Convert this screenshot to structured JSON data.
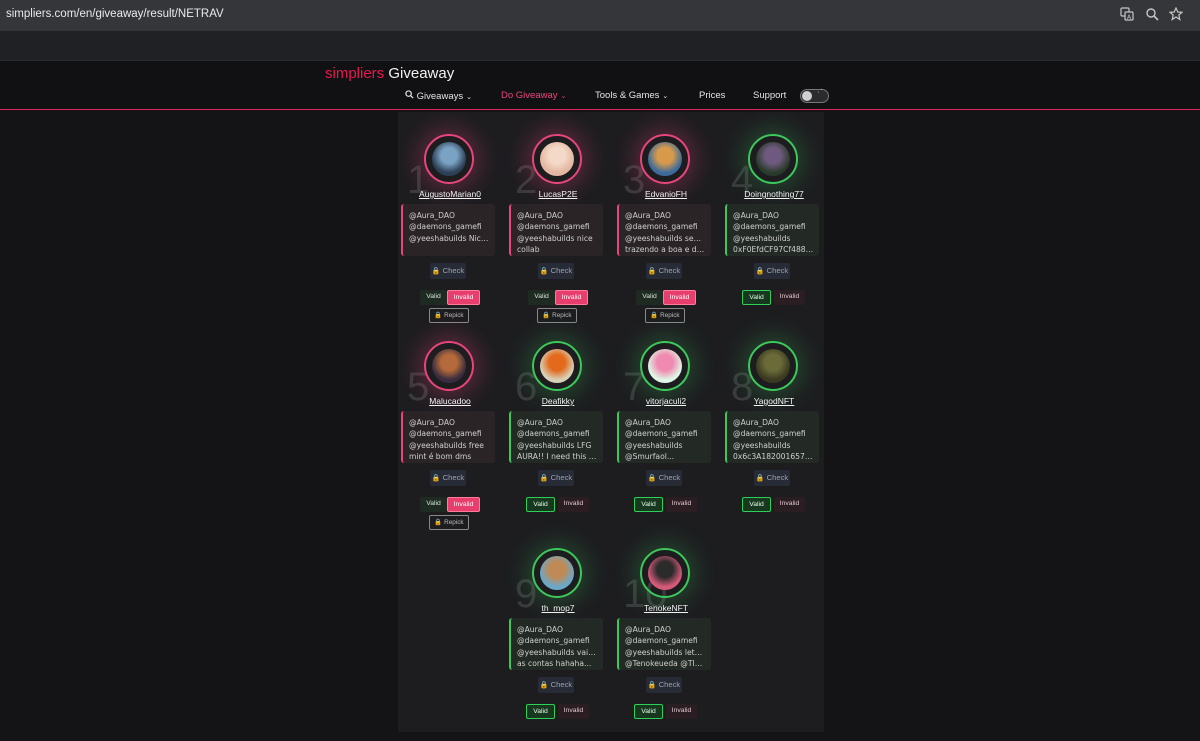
{
  "browser": {
    "url": "simpliers.com/en/giveaway/result/NETRAV",
    "icons": [
      "translate-icon",
      "zoom-icon",
      "bookmark-star-icon"
    ]
  },
  "header": {
    "brand_part1": "simpliers",
    "brand_part2": "Giveaway",
    "nav": {
      "giveaways": "Giveaways",
      "do_giveaway": "Do Giveaway",
      "tools_games": "Tools & Games",
      "prices": "Prices",
      "support": "Support"
    },
    "accent_color": "#e8174f"
  },
  "labels": {
    "check": "Check",
    "valid": "Valid",
    "invalid": "Invalid",
    "repick": "Repick"
  },
  "winners": [
    {
      "rank": "1",
      "username": "AugustoMarian0",
      "status": "invalid",
      "comment": [
        "@Aura_DAO",
        "@daemons_gamefi",
        "@yeeshabuilds Nicee"
      ]
    },
    {
      "rank": "2",
      "username": "LucasP2E",
      "status": "invalid",
      "comment": [
        "@Aura_DAO",
        "@daemons_gamefi",
        "@yeeshabuilds nice",
        "collab"
      ]
    },
    {
      "rank": "3",
      "username": "EdvanioFH",
      "status": "invalid",
      "comment": [
        "@Aura_DAO",
        "@daemons_gamefi",
        "@yeeshabuilds sempre",
        "trazendo a boa e da..."
      ]
    },
    {
      "rank": "4",
      "username": "Doingnothing77",
      "status": "valid",
      "comment": [
        "@Aura_DAO",
        "@daemons_gamefi",
        "@yeeshabuilds",
        "0xF0EfdCF97Cf488150..."
      ]
    },
    {
      "rank": "5",
      "username": "Malucadoo",
      "status": "invalid",
      "comment": [
        "@Aura_DAO",
        "@daemons_gamefi",
        "@yeeshabuilds free",
        "mint é bom dms"
      ]
    },
    {
      "rank": "6",
      "username": "Deafikky",
      "status": "valid",
      "comment": [
        "@Aura_DAO",
        "@daemons_gamefi",
        "@yeeshabuilds LFG",
        "AURA!! I need this one..."
      ]
    },
    {
      "rank": "7",
      "username": "vitorjaculi2",
      "status": "valid",
      "comment": [
        "@Aura_DAO",
        "@daemons_gamefi",
        "@yeeshabuilds",
        "@Smurfaol..."
      ]
    },
    {
      "rank": "8",
      "username": "YagodNFT",
      "status": "valid",
      "comment": [
        "@Aura_DAO",
        "@daemons_gamefi",
        "@yeeshabuilds",
        "0x6c3A182001657b2937..."
      ]
    },
    {
      "rank": "9",
      "username": "th_mop7",
      "status": "valid",
      "comment": [
        "@Aura_DAO",
        "@daemons_gamefi",
        "@yeeshabuilds vai para",
        "as contas hahaha..."
      ]
    },
    {
      "rank": "10",
      "username": "TenokeNFT",
      "status": "valid",
      "comment": [
        "@Aura_DAO",
        "@daemons_gamefi",
        "@yeeshabuilds lets fight",
        "@Tenokeueda @TINAjB..."
      ]
    }
  ],
  "colors": {
    "invalid": "#e8467a",
    "valid": "#3cc85a"
  }
}
